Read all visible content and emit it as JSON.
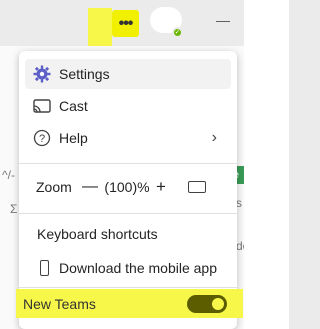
{
  "topbar": {
    "more_label": "•••",
    "minimize_label": "—",
    "presence_check": "✓"
  },
  "background": {
    "left_frag": "^/-",
    "left_frag2": "Σ",
    "right_frag_e": "e",
    "right_frag_s": "s",
    "right_frag_dc": "dc",
    "right_frag_c": "c"
  },
  "menu": {
    "settings_label": "Settings",
    "cast_label": "Cast",
    "help_label": "Help",
    "help_chevron": "›",
    "zoom_label": "Zoom",
    "zoom_out": "—",
    "zoom_value": "(100)%",
    "zoom_in": "+",
    "keyboard_label": "Keyboard shortcuts",
    "mobile_label": "Download the mobile app",
    "new_teams_label": "New Teams",
    "new_teams_on": true
  },
  "colors": {
    "highlight": "#f7f74a",
    "settings_icon": "#5b5fc7",
    "presence": "#6bb700"
  }
}
